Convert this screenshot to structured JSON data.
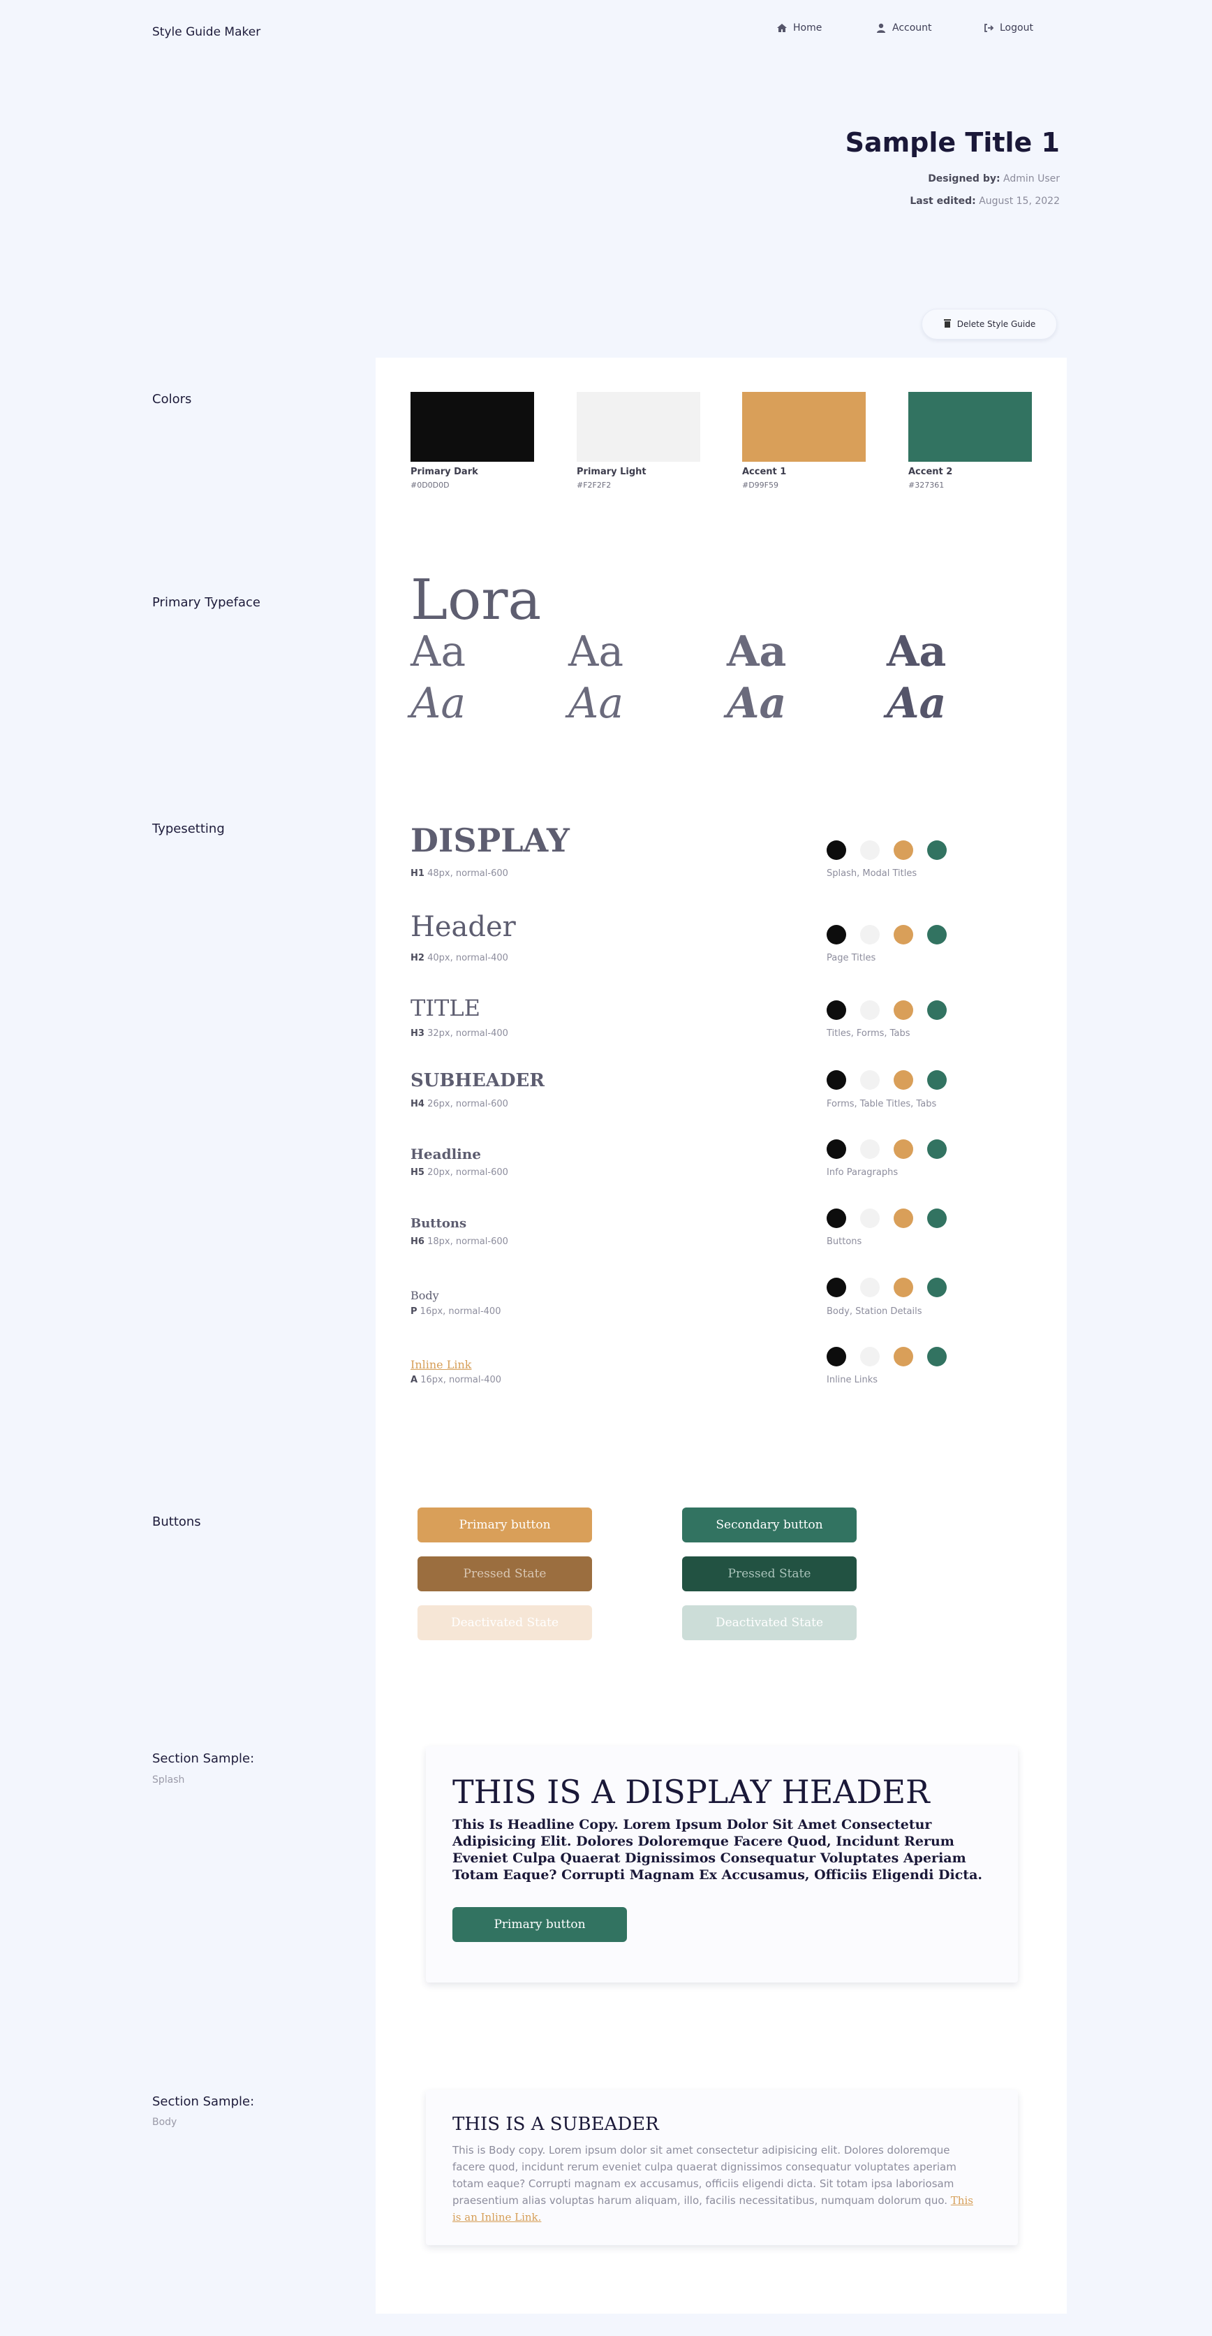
{
  "nav": {
    "brand": "Style Guide Maker",
    "home": "Home",
    "account": "Account",
    "logout": "Logout"
  },
  "header": {
    "title": "Sample Title 1",
    "designed_by_label": "Designed by:",
    "designed_by_value": "Admin User",
    "last_edited_label": "Last edited:",
    "last_edited_value": "August 15, 2022",
    "delete_label": "Delete Style Guide"
  },
  "colors": {
    "section_label": "Colors",
    "items": [
      {
        "name": "Primary Dark",
        "hex": "#0D0D0D"
      },
      {
        "name": "Primary Light",
        "hex": "#F2F2F2"
      },
      {
        "name": "Accent 1",
        "hex": "#D99F59"
      },
      {
        "name": "Accent 2",
        "hex": "#327361"
      }
    ]
  },
  "typeface": {
    "section_label": "Primary Typeface",
    "name": "Lora",
    "sample": "Aa"
  },
  "typesetting": {
    "section_label": "Typesetting",
    "rows": [
      {
        "sample": "DISPLAY",
        "tag": "H1",
        "spec": "48px, normal-600",
        "usage": "Splash, Modal Titles"
      },
      {
        "sample": "Header",
        "tag": "H2",
        "spec": "40px, normal-400",
        "usage": "Page Titles"
      },
      {
        "sample": "TITLE",
        "tag": "H3",
        "spec": "32px, normal-400",
        "usage": "Titles, Forms, Tabs"
      },
      {
        "sample": "SUBHEADER",
        "tag": "H4",
        "spec": "26px, normal-600",
        "usage": "Forms, Table Titles, Tabs"
      },
      {
        "sample": "Headline",
        "tag": "H5",
        "spec": "20px, normal-600",
        "usage": "Info Paragraphs"
      },
      {
        "sample": "Buttons",
        "tag": "H6",
        "spec": "18px, normal-600",
        "usage": "Buttons"
      },
      {
        "sample": "Body",
        "tag": "P",
        "spec": "16px, normal-400",
        "usage": "Body, Station Details"
      },
      {
        "sample": "Inline Link",
        "tag": "A",
        "spec": "16px, normal-400",
        "usage": "Inline Links"
      }
    ]
  },
  "buttons": {
    "section_label": "Buttons",
    "primary": "Primary button",
    "secondary": "Secondary button",
    "pressed": "Pressed State",
    "deactivated": "Deactivated State"
  },
  "splash": {
    "section_label": "Section Sample:",
    "section_sub": "Splash",
    "display": "THIS IS A DISPLAY HEADER",
    "copy": "This Is Headline Copy. Lorem Ipsum Dolor Sit Amet Consectetur Adipisicing Elit. Dolores Doloremque Facere Quod, Incidunt Rerum Eveniet Culpa Quaerat Dignissimos Consequatur Voluptates Aperiam Totam Eaque? Corrupti Magnam Ex Accusamus, Officiis Eligendi Dicta.",
    "button": "Primary button"
  },
  "body_sample": {
    "section_label": "Section Sample:",
    "section_sub": "Body",
    "subheader": "THIS IS A SUBEADER",
    "copy": "This is Body copy. Lorem ipsum dolor sit amet consectetur adipisicing elit. Dolores doloremque facere quod, incidunt rerum eveniet culpa quaerat dignissimos consequatur voluptates aperiam totam eaque? Corrupti magnam ex accusamus, officiis eligendi dicta. Sit totam ipsa laboriosam praesentium alias voluptas harum aliquam, illo, facilis necessitatibus, numquam dolorum quo.",
    "link": "This is an Inline Link."
  },
  "palette": {
    "dark": "#0D0D0D",
    "light": "#F2F2F2",
    "accent1": "#D99F59",
    "accent2": "#327361",
    "accent1_pressed": "#9B6E3F",
    "accent2_pressed": "#225242",
    "accent1_disabled": "#F6E6D6",
    "accent2_disabled": "#CCDDD8"
  }
}
